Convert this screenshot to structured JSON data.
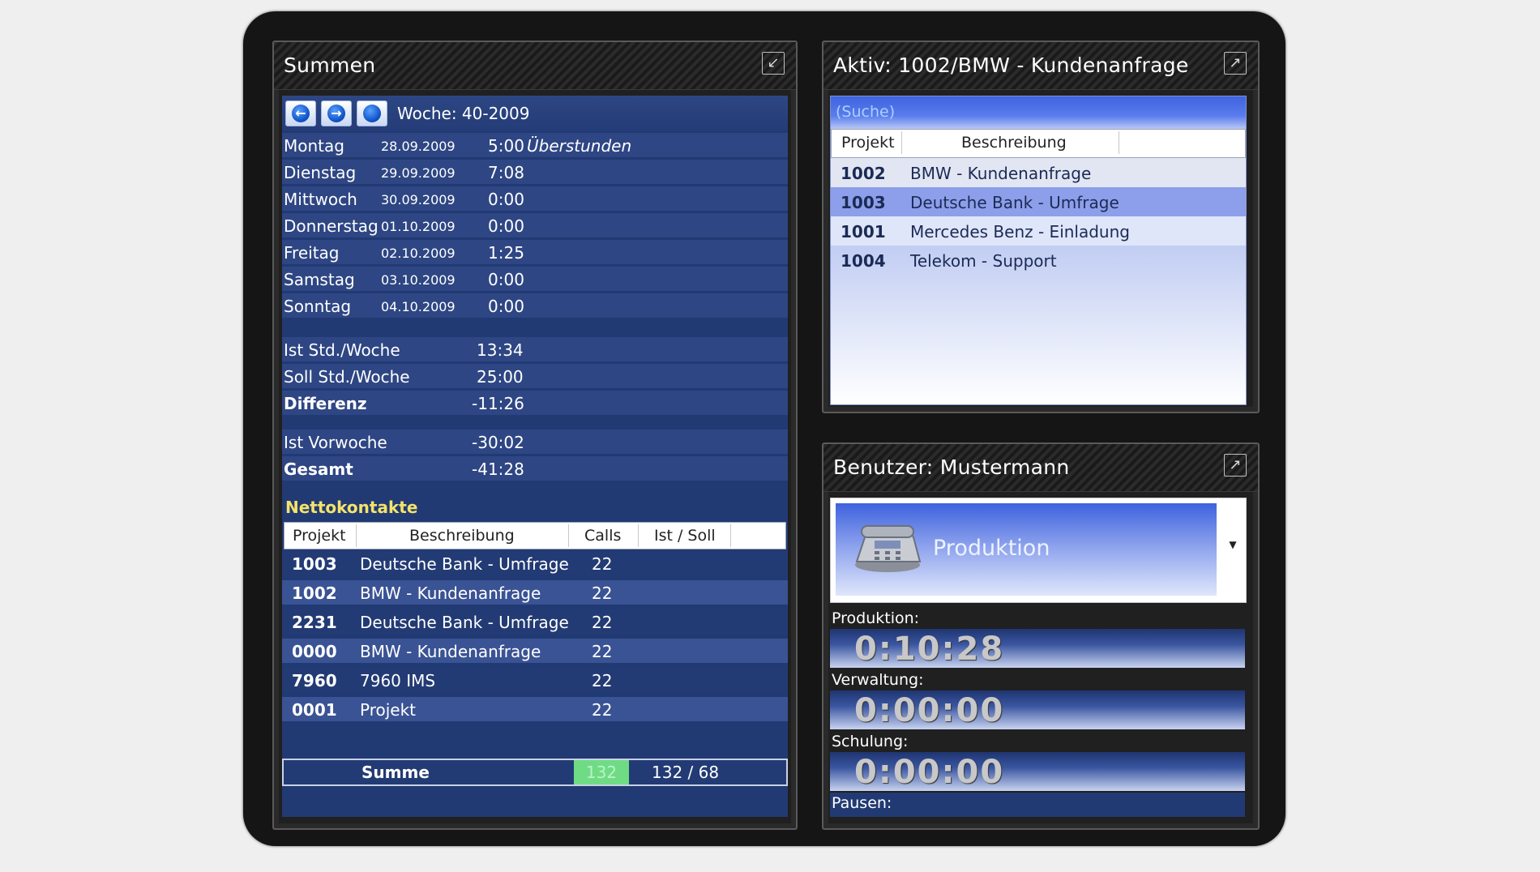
{
  "summen": {
    "title": "Summen",
    "week": "Woche: 40-2009",
    "days": [
      {
        "day": "Montag",
        "date": "28.09.2009",
        "time": "5:00",
        "note": "Überstunden"
      },
      {
        "day": "Dienstag",
        "date": "29.09.2009",
        "time": "7:08",
        "note": ""
      },
      {
        "day": "Mittwoch",
        "date": "30.09.2009",
        "time": "0:00",
        "note": ""
      },
      {
        "day": "Donnerstag",
        "date": "01.10.2009",
        "time": "0:00",
        "note": ""
      },
      {
        "day": "Freitag",
        "date": "02.10.2009",
        "time": "1:25",
        "note": ""
      },
      {
        "day": "Samstag",
        "date": "03.10.2009",
        "time": "0:00",
        "note": ""
      },
      {
        "day": "Sonntag",
        "date": "04.10.2009",
        "time": "0:00",
        "note": ""
      }
    ],
    "stats": [
      {
        "label": "Ist Std./Woche",
        "value": "13:34"
      },
      {
        "label": "Soll Std./Woche",
        "value": "25:00"
      },
      {
        "label": "Differenz",
        "value": "-11:26"
      },
      {
        "label": "Ist Vorwoche",
        "value": "-30:02"
      },
      {
        "label": "Gesamt",
        "value": "-41:28"
      }
    ],
    "netto_title": "Nettokontakte",
    "netto_headers": [
      "Projekt",
      "Beschreibung",
      "Calls",
      "Ist / Soll"
    ],
    "netto_rows": [
      {
        "projekt": "1003",
        "beschreibung": "Deutsche Bank - Umfrage",
        "calls": "22"
      },
      {
        "projekt": "1002",
        "beschreibung": "BMW - Kundenanfrage",
        "calls": "22"
      },
      {
        "projekt": "2231",
        "beschreibung": "Deutsche Bank - Umfrage",
        "calls": "22"
      },
      {
        "projekt": "0000",
        "beschreibung": "BMW - Kundenanfrage",
        "calls": "22"
      },
      {
        "projekt": "7960",
        "beschreibung": "7960 IMS",
        "calls": "22"
      },
      {
        "projekt": "0001",
        "beschreibung": "Projekt",
        "calls": "22"
      }
    ],
    "summe_label": "Summe",
    "summe_calls": "132",
    "summe_ratio": "132 / 68"
  },
  "aktiv": {
    "title": "Aktiv: 1002/BMW - Kundenanfrage",
    "search_placeholder": "(Suche)",
    "headers": [
      "Projekt",
      "Beschreibung"
    ],
    "rows": [
      {
        "projekt": "1002",
        "beschreibung": "BMW - Kundenanfrage"
      },
      {
        "projekt": "1003",
        "beschreibung": "Deutsche Bank - Umfrage"
      },
      {
        "projekt": "1001",
        "beschreibung": "Mercedes Benz - Einladung"
      },
      {
        "projekt": "1004",
        "beschreibung": "Telekom - Support"
      }
    ]
  },
  "benutzer": {
    "title": "Benutzer: Mustermann",
    "status": "Produktion",
    "timers": [
      {
        "label": "Produktion:",
        "value": "0:10:28"
      },
      {
        "label": "Verwaltung:",
        "value": "0:00:00"
      },
      {
        "label": "Schulung:",
        "value": "0:00:00"
      },
      {
        "label": "Pausen:",
        "value": ""
      }
    ]
  },
  "colors": {
    "panel_blue": "#223a73",
    "row_blue": "#2e4683",
    "accent_yellow": "#f4e36b",
    "calls_green": "#6fdc85"
  }
}
